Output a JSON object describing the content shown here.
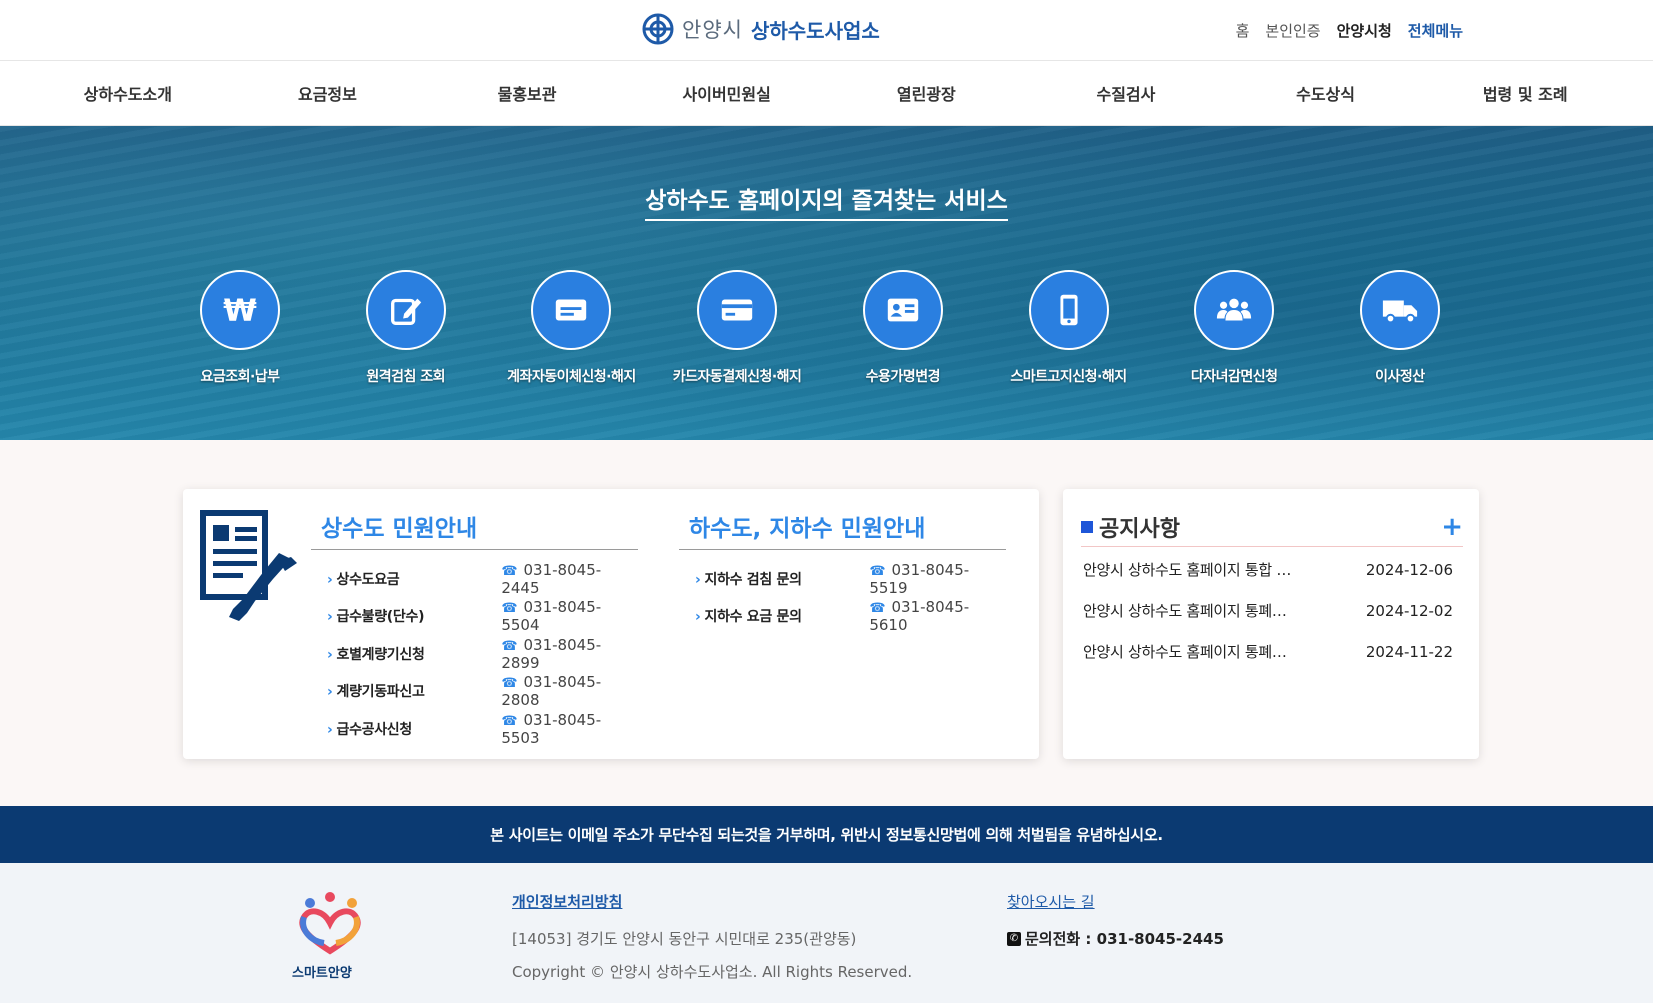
{
  "header": {
    "city": "안양시",
    "dept": "상하수도사업소",
    "util_links": [
      "홈",
      "본인인증",
      "안양시청",
      "전체메뉴"
    ]
  },
  "nav": [
    "상하수도소개",
    "요금정보",
    "물홍보관",
    "사이버민원실",
    "열린광장",
    "수질검사",
    "수도상식",
    "법령 및 조례"
  ],
  "hero": {
    "title": "상하수도 홈페이지의 즐겨찾는 서비스",
    "services": [
      {
        "label": "요금조회·납부",
        "icon": "won-icon"
      },
      {
        "label": "원격검침 조회",
        "icon": "edit-icon"
      },
      {
        "label": "계좌자동이체신청·해지",
        "icon": "account-card-icon"
      },
      {
        "label": "카드자동결제신청·해지",
        "icon": "credit-card-icon"
      },
      {
        "label": "수용가명변경",
        "icon": "id-card-icon"
      },
      {
        "label": "스마트고지신청·해지",
        "icon": "smartphone-icon"
      },
      {
        "label": "다자녀감면신청",
        "icon": "users-icon"
      },
      {
        "label": "이사정산",
        "icon": "truck-icon"
      }
    ]
  },
  "water_supply": {
    "title": "상수도 민원안내",
    "rows": [
      {
        "label": "상수도요금",
        "tel": "031-8045-2445"
      },
      {
        "label": "급수불량(단수)",
        "tel": "031-8045-5504"
      },
      {
        "label": "호별계량기신청",
        "tel": "031-8045-2899"
      },
      {
        "label": "계량기동파신고",
        "tel": "031-8045-2808"
      },
      {
        "label": "급수공사신청",
        "tel": "031-8045-5503"
      }
    ]
  },
  "sewer": {
    "title": "하수도, 지하수 민원안내",
    "rows": [
      {
        "label": "지하수 검침 문의",
        "tel": "031-8045-5519"
      },
      {
        "label": "지하수 요금 문의",
        "tel": "031-8045-5610"
      }
    ]
  },
  "notice": {
    "title": "공지사항",
    "more": "+",
    "items": [
      {
        "title": "안양시 상하수도 홈페이지 통합 …",
        "date": "2024-12-06"
      },
      {
        "title": "안양시 상하수도 홈페이지 통폐…",
        "date": "2024-12-02"
      },
      {
        "title": "안양시 상하수도 홈페이지 통폐…",
        "date": "2024-11-22"
      }
    ]
  },
  "footer": {
    "email_notice": "본 사이트는 이메일 주소가 무단수집 되는것을 거부하며, 위반시 정보통신망법에 의해 처벌됨을 유념하십시오.",
    "smart_logo_text": "스마트안양",
    "privacy": "개인정보처리방침",
    "address": "[14053] 경기도 안양시 동안구 시민대로 235(관양동)",
    "copyright": "Copyright © 안양시 상하수도사업소. All Rights Reserved.",
    "directions": "찾아오시는 길",
    "phone": "문의전화 : 031-8045-2445"
  },
  "colors": {
    "brand_navy": "#0b3a72",
    "accent_blue": "#2e87e6",
    "service_circle": "#2a7fe0"
  }
}
